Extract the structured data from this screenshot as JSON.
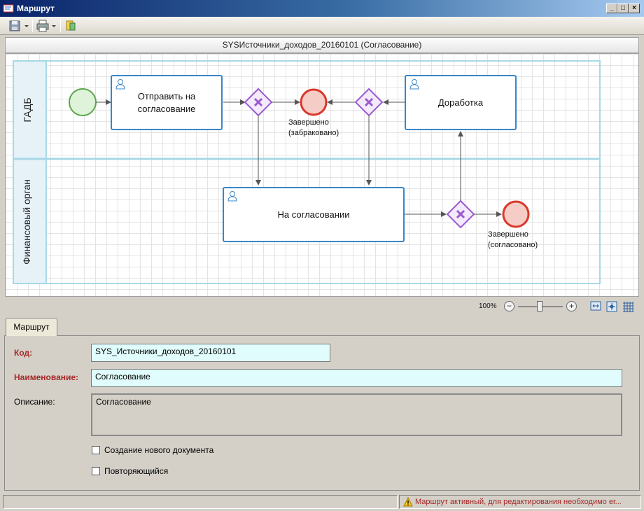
{
  "window": {
    "title": "Маршрут"
  },
  "toolbar": {
    "save": "save-icon",
    "print": "print-icon",
    "export": "export-icon"
  },
  "diagram": {
    "header": "SYSИсточники_доходов_20160101 (Согласование)",
    "lanes": [
      "ГАДБ",
      "Финансовый орган"
    ],
    "tasks": {
      "send": "Отправить на\nсогласование",
      "rework": "Доработка",
      "approval": "На согласовании"
    },
    "events": {
      "rejected": "Завершено\n(забраковано)",
      "approved": "Завершено\n(согласовано)"
    },
    "colors": {
      "lane_border": "#a8d8e6",
      "task_border": "#3a86c8",
      "gateway": "#9b59d0",
      "end": "#d9382c",
      "start": "#5aa84a"
    }
  },
  "zoom": {
    "level": "100%",
    "zoom_out": "−",
    "zoom_in": "+"
  },
  "tab": {
    "label": "Маршрут"
  },
  "form": {
    "code_label": "Код:",
    "code_value": "SYS_Источники_доходов_20160101",
    "name_label": "Наименование:",
    "name_value": "Согласование",
    "desc_label": "Описание:",
    "desc_value": "Согласование",
    "check_new_doc": "Создание нового документа",
    "check_repeat": "Повторяющийся"
  },
  "status": {
    "message": "Маршрут активный, для редактирования необходимо ег..."
  }
}
